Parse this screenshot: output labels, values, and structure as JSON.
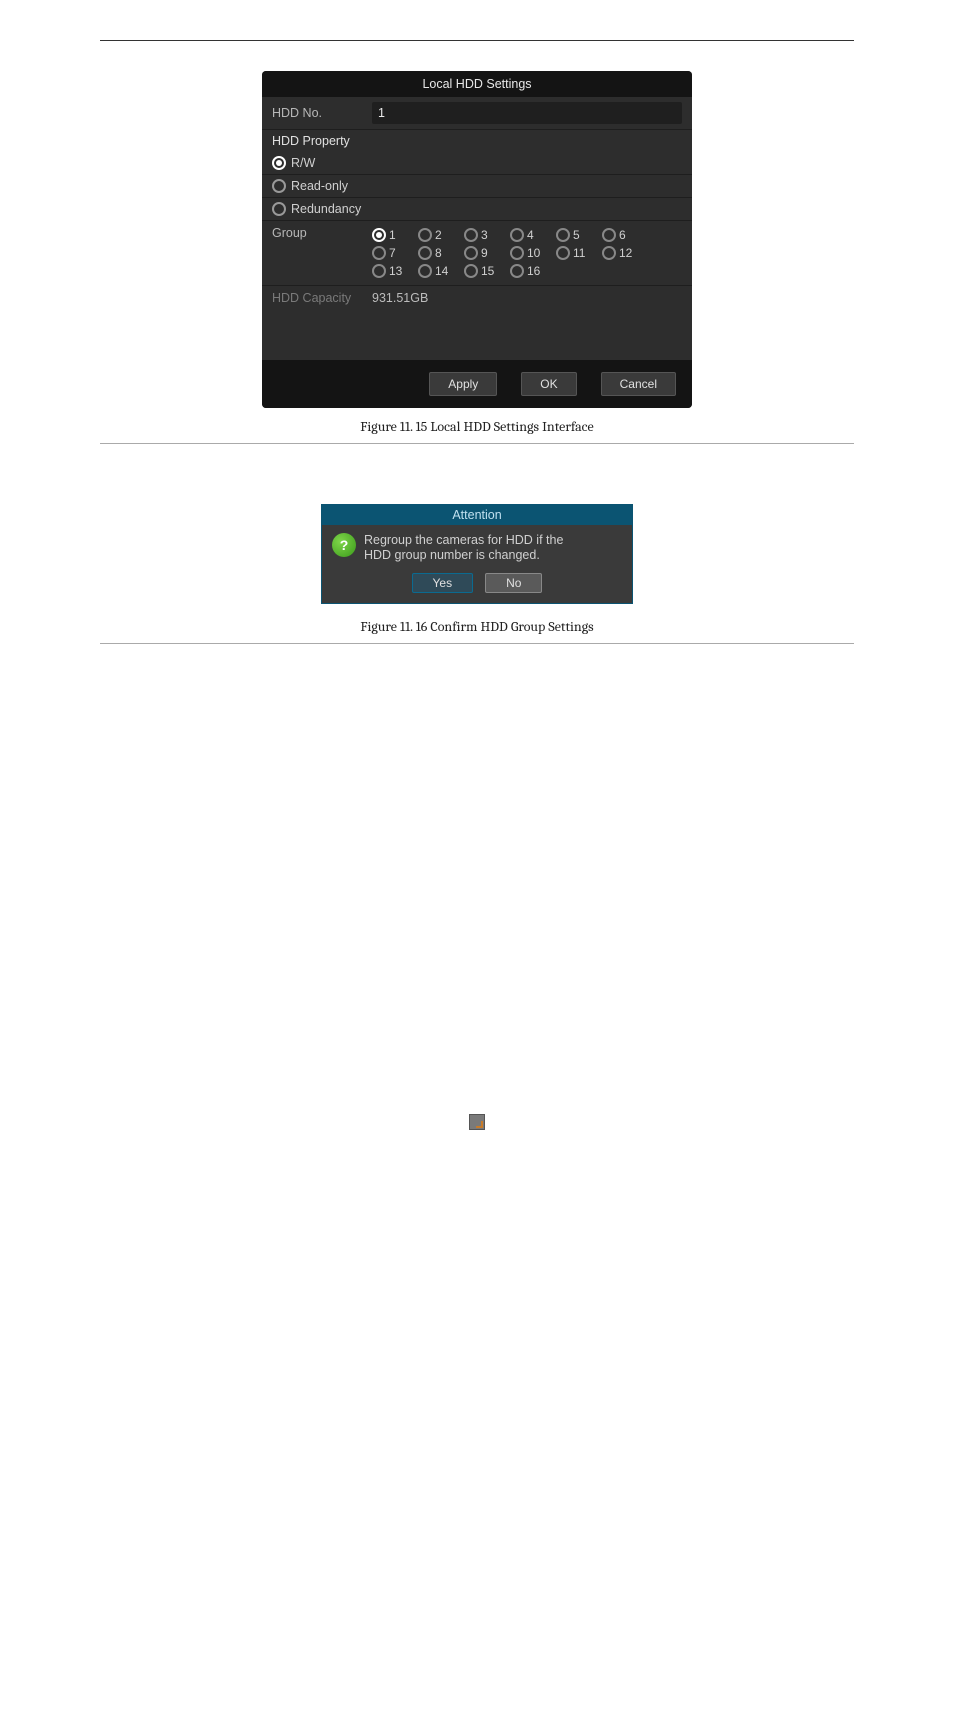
{
  "page": {
    "figure1_caption": "Figure 11. 15 Local HDD Settings Interface",
    "figure2_caption": "Figure 11. 16 Confirm HDD Group Settings"
  },
  "hdd_dialog": {
    "title": "Local HDD Settings",
    "hdd_no_label": "HDD No.",
    "hdd_no_value": "1",
    "property_header": "HDD Property",
    "prop_rw": "R/W",
    "prop_readonly": "Read-only",
    "prop_redundancy": "Redundancy",
    "property_selected": "R/W",
    "group_label": "Group",
    "group_selected": 1,
    "groups": [
      "1",
      "2",
      "3",
      "4",
      "5",
      "6",
      "7",
      "8",
      "9",
      "10",
      "11",
      "12",
      "13",
      "14",
      "15",
      "16"
    ],
    "capacity_label": "HDD Capacity",
    "capacity_value": "931.51GB",
    "btn_apply": "Apply",
    "btn_ok": "OK",
    "btn_cancel": "Cancel"
  },
  "attention_dialog": {
    "title": "Attention",
    "message_line1": "Regroup the cameras for HDD if the",
    "message_line2": "HDD group number is changed.",
    "btn_yes": "Yes",
    "btn_no": "No"
  }
}
